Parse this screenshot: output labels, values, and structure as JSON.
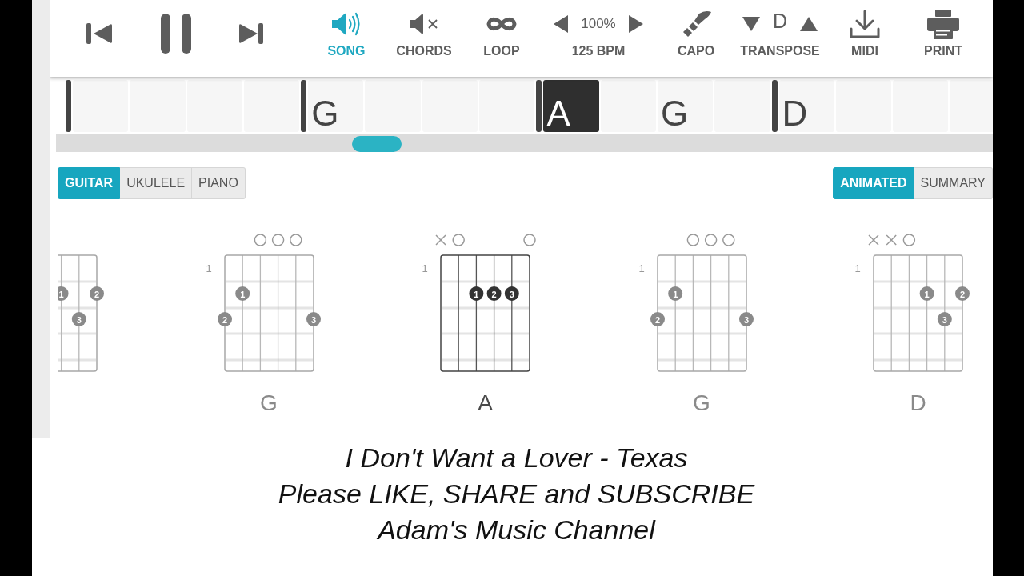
{
  "player": {
    "transport": [
      {
        "kind": "previous"
      },
      {
        "kind": "pause"
      },
      {
        "kind": "next"
      }
    ],
    "audio_modes": [
      {
        "kind": "song",
        "label": "SONG",
        "selected": true
      },
      {
        "kind": "chords",
        "label": "CHORDS",
        "selected": false
      }
    ],
    "tools": [
      {
        "kind": "loop",
        "label": "LOOP"
      },
      {
        "kind": "tempo",
        "value": "100%",
        "label": "125 BPM"
      },
      {
        "kind": "capo",
        "label": "CAPO"
      },
      {
        "kind": "transpose",
        "value": "D",
        "label": "TRANSPOSE"
      },
      {
        "kind": "midi",
        "label": "MIDI"
      },
      {
        "kind": "print",
        "label": "PRINT"
      }
    ]
  },
  "timeline": {
    "bars": [
      {
        "beats": [
          {
            "current": false
          },
          {
            "current": false
          },
          {
            "current": false
          },
          {
            "current": false
          }
        ]
      },
      {
        "beats": [
          {
            "chord": "G",
            "current": false
          },
          {
            "current": false
          },
          {
            "current": false
          },
          {
            "current": false
          }
        ]
      },
      {
        "beats": [
          {
            "chord": "A",
            "current": true
          },
          {
            "current": false
          },
          {
            "chord": "G",
            "current": false
          },
          {
            "current": false
          }
        ]
      },
      {
        "beats": [
          {
            "chord": "D",
            "current": false
          },
          {
            "current": false
          },
          {
            "current": false
          },
          {
            "current": false
          }
        ]
      }
    ]
  },
  "instrument_tabs": [
    {
      "label": "GUITAR",
      "selected": true
    },
    {
      "label": "UKULELE",
      "selected": false
    },
    {
      "label": "PIANO",
      "selected": false
    }
  ],
  "view_tabs": [
    {
      "label": "ANIMATED",
      "selected": true
    },
    {
      "label": "SUMMARY",
      "selected": false
    }
  ],
  "chords": [
    {
      "current": false,
      "strings": [
        {
          "kind": "fret2",
          "finger": "1"
        },
        {
          "kind": "fret3",
          "finger": "3"
        },
        {
          "kind": "fret2",
          "finger": "2"
        }
      ]
    },
    {
      "name": "G",
      "fret_label": "1",
      "current": false,
      "strings": [
        {
          "kind": "fret3",
          "finger": "2"
        },
        {
          "kind": "fret2",
          "finger": "1"
        },
        {
          "kind": "open"
        },
        {
          "kind": "open"
        },
        {
          "kind": "open"
        },
        {
          "kind": "fret3",
          "finger": "3"
        }
      ]
    },
    {
      "name": "A",
      "fret_label": "1",
      "current": true,
      "strings": [
        {
          "kind": "muted"
        },
        {
          "kind": "open"
        },
        {
          "kind": "fret2",
          "finger": "1"
        },
        {
          "kind": "fret2",
          "finger": "2"
        },
        {
          "kind": "fret2",
          "finger": "3"
        },
        {
          "kind": "open"
        }
      ]
    },
    {
      "name": "G",
      "fret_label": "1",
      "current": false,
      "strings": [
        {
          "kind": "fret3",
          "finger": "2"
        },
        {
          "kind": "fret2",
          "finger": "1"
        },
        {
          "kind": "open"
        },
        {
          "kind": "open"
        },
        {
          "kind": "open"
        },
        {
          "kind": "fret3",
          "finger": "3"
        }
      ]
    },
    {
      "name": "D",
      "fret_label": "1",
      "current": false,
      "strings": [
        {
          "kind": "muted"
        },
        {
          "kind": "muted"
        },
        {
          "kind": "open"
        },
        {
          "kind": "fret2",
          "finger": "1"
        },
        {
          "kind": "fret3",
          "finger": "3"
        },
        {
          "kind": "fret2",
          "finger": "2"
        }
      ]
    }
  ],
  "caption_lines": [
    "I Don't Want a Lover - Texas",
    "Please LIKE, SHARE and SUBSCRIBE",
    "Adam's Music Channel"
  ]
}
